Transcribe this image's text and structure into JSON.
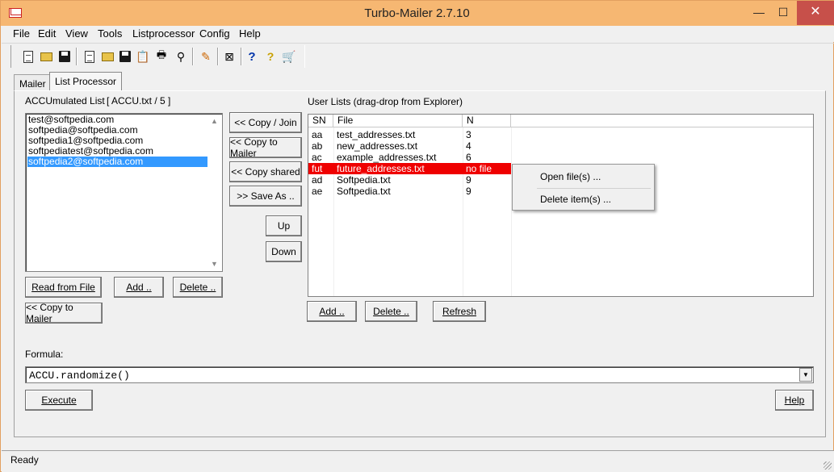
{
  "window": {
    "title": "Turbo-Mailer 2.7.10",
    "minimize": "—",
    "maximize": "☐",
    "close": "✕"
  },
  "menu": [
    "File",
    "Edit",
    "View",
    "Tools",
    "Listprocessor",
    "Config",
    "Help"
  ],
  "tabs": {
    "mailer": "Mailer",
    "list_processor": "List Processor"
  },
  "accu": {
    "title": "ACCUmulated List",
    "info": "[ ACCU.txt / 5 ]",
    "items": [
      "test@softpedia.com",
      "softpedia@softpedia.com",
      "softpedia1@softpedia.com",
      "softpediatest@softpedia.com",
      "softpedia2@softpedia.com"
    ],
    "selected_index": 4
  },
  "left_buttons": {
    "read_from_file": "Read from File",
    "add": "Add ..",
    "delete": "Delete ..",
    "copy_to_mailer": "<< Copy to Mailer"
  },
  "middle_buttons": {
    "copy_join": "<< Copy / Join",
    "copy_to_mailer": "<< Copy to Mailer",
    "copy_shared": "<< Copy shared",
    "save_as": ">> Save As ..",
    "up": "Up",
    "down": "Down"
  },
  "user_lists": {
    "title": "User Lists  (drag-drop from Explorer)",
    "columns": [
      "SN",
      "File",
      "N"
    ],
    "rows": [
      {
        "sn": "aa",
        "file": "test_addresses.txt",
        "n": "3"
      },
      {
        "sn": "ab",
        "file": "new_addresses.txt",
        "n": "4"
      },
      {
        "sn": "ac",
        "file": "example_addresses.txt",
        "n": "6"
      },
      {
        "sn": "fut",
        "file": "future_addresses.txt",
        "n": "no file"
      },
      {
        "sn": "ad",
        "file": "Softpedia.txt",
        "n": "9"
      },
      {
        "sn": "ae",
        "file": "Softpedia.txt",
        "n": "9"
      }
    ],
    "highlight_color": "#ef0000"
  },
  "user_list_buttons": {
    "add": "Add ..",
    "delete": "Delete ..",
    "refresh": "Refresh"
  },
  "context_menu": {
    "open": "Open file(s) ...",
    "delete": "Delete item(s) ..."
  },
  "formula": {
    "label": "Formula:",
    "value": "ACCU.randomize()"
  },
  "bottom_buttons": {
    "execute": "Execute",
    "help": "Help"
  },
  "status": {
    "text": "Ready"
  },
  "toolbar_icons": [
    "new-document-icon",
    "open-folder-icon",
    "save-disk-icon",
    "new-list-icon",
    "open-list-icon",
    "save-list-icon",
    "clipboard-icon",
    "print-icon",
    "find-icon",
    "edit-icon",
    "stop-icon",
    "help-icon",
    "info-icon",
    "cart-icon"
  ]
}
